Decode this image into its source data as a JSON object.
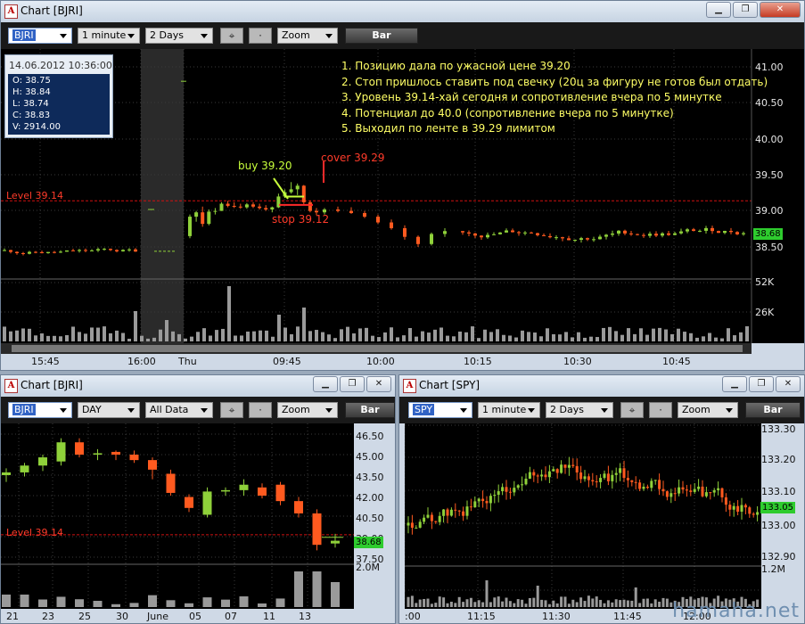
{
  "main": {
    "title": "Chart [BJRI]",
    "controls": {
      "symbol": "BJRI",
      "interval": "1 minute",
      "range": "2 Days",
      "zoom": "Zoom",
      "bar": "Bar"
    },
    "ohlc": {
      "date": "14.06.2012 10:36:00",
      "o": "O: 38.75",
      "h": "H: 38.84",
      "l": "L: 38.74",
      "c": "C: 38.83",
      "v": "V: 2914.00"
    },
    "notes": [
      "1. Позицию дала по ужасной цене 39.20",
      "2. Стоп пришлось ставить под свечку (20ц за фигуру не готов был отдать)",
      "3. Уровень 39.14-хай сегодня и сопротивление вчера по 5 минутке",
      "4. Потенциал до 40.0 (сопротивление вчера по 5 минутке)",
      "5. Выходил по ленте в 39.29  лимитом"
    ],
    "labels": {
      "buy": "buy 39.20",
      "cover": "cover 39.29",
      "stop": "stop 39.12",
      "level": "Level 39.14"
    },
    "price_axis": [
      "41.00",
      "40.50",
      "40.00",
      "39.50",
      "39.00",
      "38.50"
    ],
    "last_price": "38.68",
    "volume_axis": [
      "52K",
      "26K"
    ],
    "time_axis": [
      "15:45",
      "16:00",
      "Thu",
      "09:45",
      "10:00",
      "10:15",
      "10:30",
      "10:45"
    ]
  },
  "daily": {
    "title": "Chart [BJRI]",
    "controls": {
      "symbol": "BJRI",
      "interval": "DAY",
      "range": "All Data",
      "zoom": "Zoom",
      "bar": "Bar"
    },
    "level_label": "Level 39.14",
    "price_axis": [
      "46.50",
      "45.00",
      "43.50",
      "42.00",
      "40.50",
      "39.00",
      "37.50"
    ],
    "last_price": "38.68",
    "volume_axis": [
      "2.0M"
    ],
    "time_axis": [
      "21",
      "23",
      "25",
      "30",
      "June",
      "05",
      "07",
      "11",
      "13"
    ]
  },
  "spy": {
    "title": "Chart [SPY]",
    "controls": {
      "symbol": "SPY",
      "interval": "1 minute",
      "range": "2 Days",
      "zoom": "Zoom",
      "bar": "Bar"
    },
    "price_axis": [
      "133.30",
      "133.20",
      "133.10",
      "133.00",
      "132.90"
    ],
    "last_price": "133.05",
    "volume_axis": [
      "1.2M"
    ],
    "time_axis": [
      ":00",
      "11:15",
      "11:30",
      "11:45",
      "12:00"
    ]
  },
  "colors": {
    "up": "#8fd13a",
    "down": "#ff5a1f",
    "level": "#d01010",
    "annotation": "#ffff66",
    "buy": "#c8ff3c",
    "tag": "#2ecc2e"
  },
  "watermark": "hamaha.net"
}
